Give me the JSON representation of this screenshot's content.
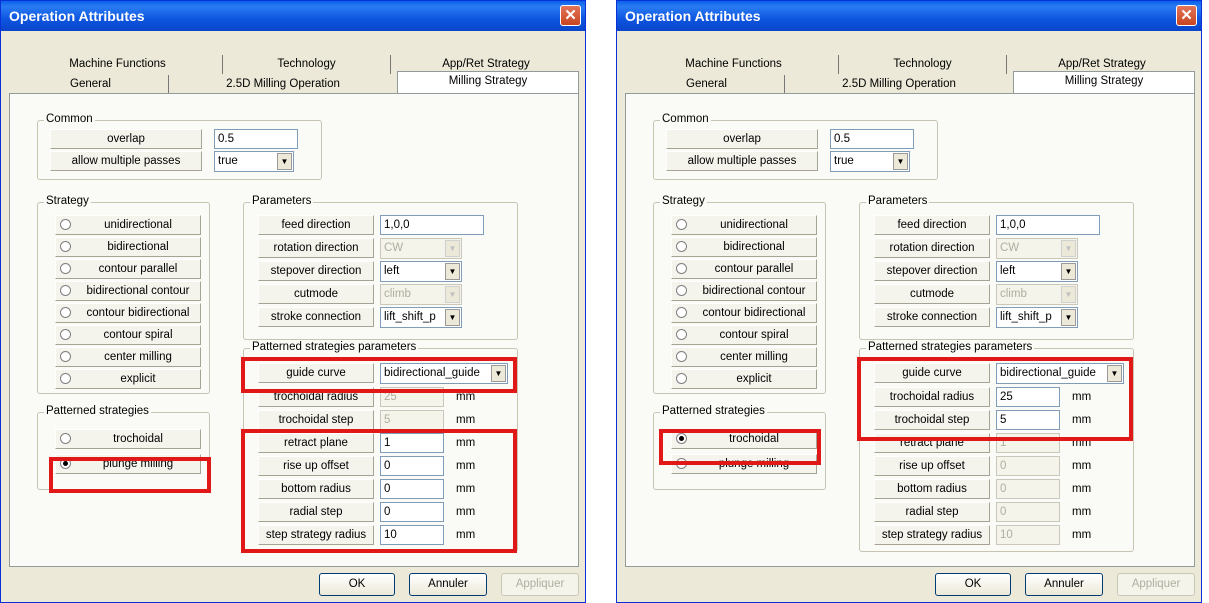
{
  "dialogs": [
    {
      "title": "Operation Attributes",
      "tabs_row1": [
        "Machine Functions",
        "Technology",
        "App/Ret Strategy"
      ],
      "tabs_row2": [
        "General",
        "2.5D Milling Operation",
        "Milling Strategy"
      ],
      "common": {
        "label": "Common",
        "overlap_label": "overlap",
        "overlap_value": "0.5",
        "multi_label": "allow multiple passes",
        "multi_value": "true"
      },
      "strategy": {
        "label": "Strategy",
        "options": [
          "unidirectional",
          "bidirectional",
          "contour parallel",
          "bidirectional contour",
          "contour bidirectional",
          "contour spiral",
          "center milling",
          "explicit"
        ]
      },
      "patterned": {
        "label": "Patterned strategies",
        "options": [
          "trochoidal",
          "plunge milling"
        ],
        "selected": "plunge milling"
      },
      "parameters": {
        "label": "Parameters",
        "feed_label": "feed direction",
        "feed_value": "1,0,0",
        "rotation_label": "rotation direction",
        "rotation_value": "CW",
        "stepover_label": "stepover direction",
        "stepover_value": "left",
        "cutmode_label": "cutmode",
        "cutmode_value": "climb",
        "stroke_label": "stroke connection",
        "stroke_value": "lift_shift_p"
      },
      "patterned_params": {
        "label": "Patterned strategies parameters",
        "guide_label": "guide curve",
        "guide_value": "bidirectional_guide",
        "rows": [
          {
            "label": "trochoidal radius",
            "value": "25",
            "unit": "mm",
            "enabled": false
          },
          {
            "label": "trochoidal step",
            "value": "5",
            "unit": "mm",
            "enabled": false
          },
          {
            "label": "retract plane",
            "value": "1",
            "unit": "mm",
            "enabled": true
          },
          {
            "label": "rise up offset",
            "value": "0",
            "unit": "mm",
            "enabled": true
          },
          {
            "label": "bottom radius",
            "value": "0",
            "unit": "mm",
            "enabled": true
          },
          {
            "label": "radial step",
            "value": "0",
            "unit": "mm",
            "enabled": true
          },
          {
            "label": "step strategy radius",
            "value": "10",
            "unit": "mm",
            "enabled": true
          }
        ]
      },
      "buttons": {
        "ok": "OK",
        "cancel": "Annuler",
        "apply": "Appliquer"
      }
    },
    {
      "title": "Operation Attributes",
      "tabs_row1": [
        "Machine Functions",
        "Technology",
        "App/Ret Strategy"
      ],
      "tabs_row2": [
        "General",
        "2.5D Milling Operation",
        "Milling Strategy"
      ],
      "common": {
        "label": "Common",
        "overlap_label": "overlap",
        "overlap_value": "0.5",
        "multi_label": "allow multiple passes",
        "multi_value": "true"
      },
      "strategy": {
        "label": "Strategy",
        "options": [
          "unidirectional",
          "bidirectional",
          "contour parallel",
          "bidirectional contour",
          "contour bidirectional",
          "contour spiral",
          "center milling",
          "explicit"
        ]
      },
      "patterned": {
        "label": "Patterned strategies",
        "options": [
          "trochoidal",
          "plunge milling"
        ],
        "selected": "trochoidal"
      },
      "parameters": {
        "label": "Parameters",
        "feed_label": "feed direction",
        "feed_value": "1,0,0",
        "rotation_label": "rotation direction",
        "rotation_value": "CW",
        "stepover_label": "stepover direction",
        "stepover_value": "left",
        "cutmode_label": "cutmode",
        "cutmode_value": "climb",
        "stroke_label": "stroke connection",
        "stroke_value": "lift_shift_p"
      },
      "patterned_params": {
        "label": "Patterned strategies parameters",
        "guide_label": "guide curve",
        "guide_value": "bidirectional_guide",
        "rows": [
          {
            "label": "trochoidal radius",
            "value": "25",
            "unit": "mm",
            "enabled": true
          },
          {
            "label": "trochoidal step",
            "value": "5",
            "unit": "mm",
            "enabled": true
          },
          {
            "label": "retract plane",
            "value": "1",
            "unit": "mm",
            "enabled": false
          },
          {
            "label": "rise up offset",
            "value": "0",
            "unit": "mm",
            "enabled": false
          },
          {
            "label": "bottom radius",
            "value": "0",
            "unit": "mm",
            "enabled": false
          },
          {
            "label": "radial step",
            "value": "0",
            "unit": "mm",
            "enabled": false
          },
          {
            "label": "step strategy radius",
            "value": "10",
            "unit": "mm",
            "enabled": false
          }
        ]
      },
      "buttons": {
        "ok": "OK",
        "cancel": "Annuler",
        "apply": "Appliquer"
      }
    }
  ]
}
